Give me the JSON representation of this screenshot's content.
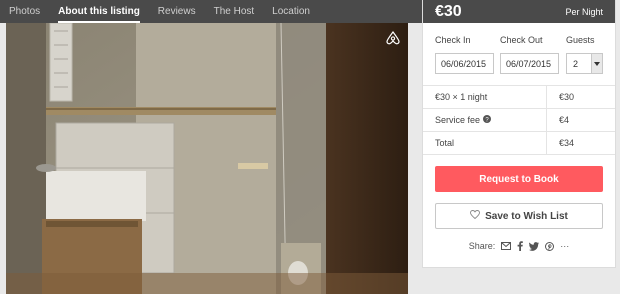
{
  "nav": {
    "items": [
      {
        "label": "Photos"
      },
      {
        "label": "About this listing"
      },
      {
        "label": "Reviews"
      },
      {
        "label": "The Host"
      },
      {
        "label": "Location"
      }
    ],
    "active_index": 1
  },
  "booking": {
    "price": "€30",
    "per_night": "Per Night",
    "check_in_label": "Check In",
    "check_out_label": "Check Out",
    "guests_label": "Guests",
    "check_in_value": "06/06/2015",
    "check_out_value": "06/07/2015",
    "guests_value": "2"
  },
  "breakdown": {
    "rows": [
      {
        "label": "€30 × 1 night",
        "value": "€30"
      },
      {
        "label": "Service fee",
        "value": "€4",
        "has_info_icon": true
      },
      {
        "label": "Total",
        "value": "€34"
      }
    ]
  },
  "actions": {
    "request_label": "Request to Book",
    "wishlist_label": "Save to Wish List"
  },
  "share": {
    "label": "Share:",
    "icons": [
      "email-icon",
      "facebook-icon",
      "twitter-icon",
      "pinterest-icon",
      "more-icon"
    ],
    "more_label": "···"
  },
  "colors": {
    "accent": "#ff5a5f",
    "header": "#4a4a4a"
  }
}
